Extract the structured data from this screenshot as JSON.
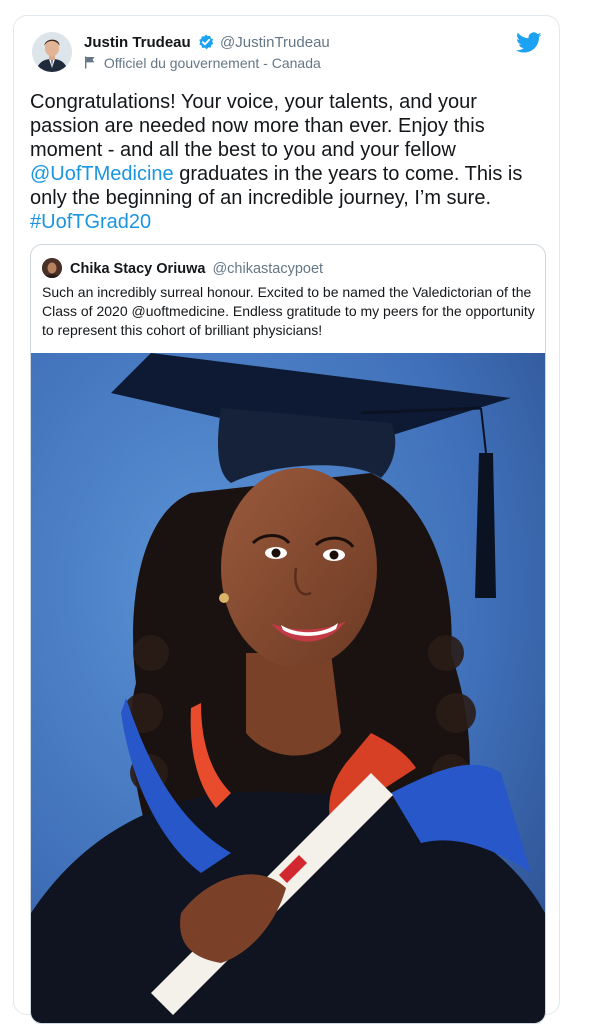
{
  "author": {
    "name": "Justin Trudeau",
    "handle": "@JustinTrudeau",
    "label": "Officiel du gouvernement - Canada"
  },
  "icons": {
    "verified": "verified-badge-icon",
    "flag": "government-flag-icon",
    "logo": "twitter-bird-icon"
  },
  "colors": {
    "link": "#1b95e0",
    "twitter_blue": "#1da1f2",
    "text": "#14171a",
    "secondary": "#657786",
    "border": "#e1e8ed"
  },
  "tweet": {
    "part1": "Congratulations! Your voice, your talents, and your passion are needed now more than ever. Enjoy this moment - and all the best to you and your fellow ",
    "mention": "@UofTMedicine",
    "part2": " graduates in the years to come. This is only the beginning of an incredible journey, I’m sure. ",
    "hashtag": "#UofTGrad20"
  },
  "quoted_tweet": {
    "name": "Chika Stacy Oriuwa",
    "handle": "@chikastacypoet",
    "text": "Such an incredibly surreal honour. Excited to be named the Valedictorian of the Class of 2020 @uoftmedicine. Endless gratitude to my peers for the opportunity to represent this cohort of brilliant physicians!"
  }
}
